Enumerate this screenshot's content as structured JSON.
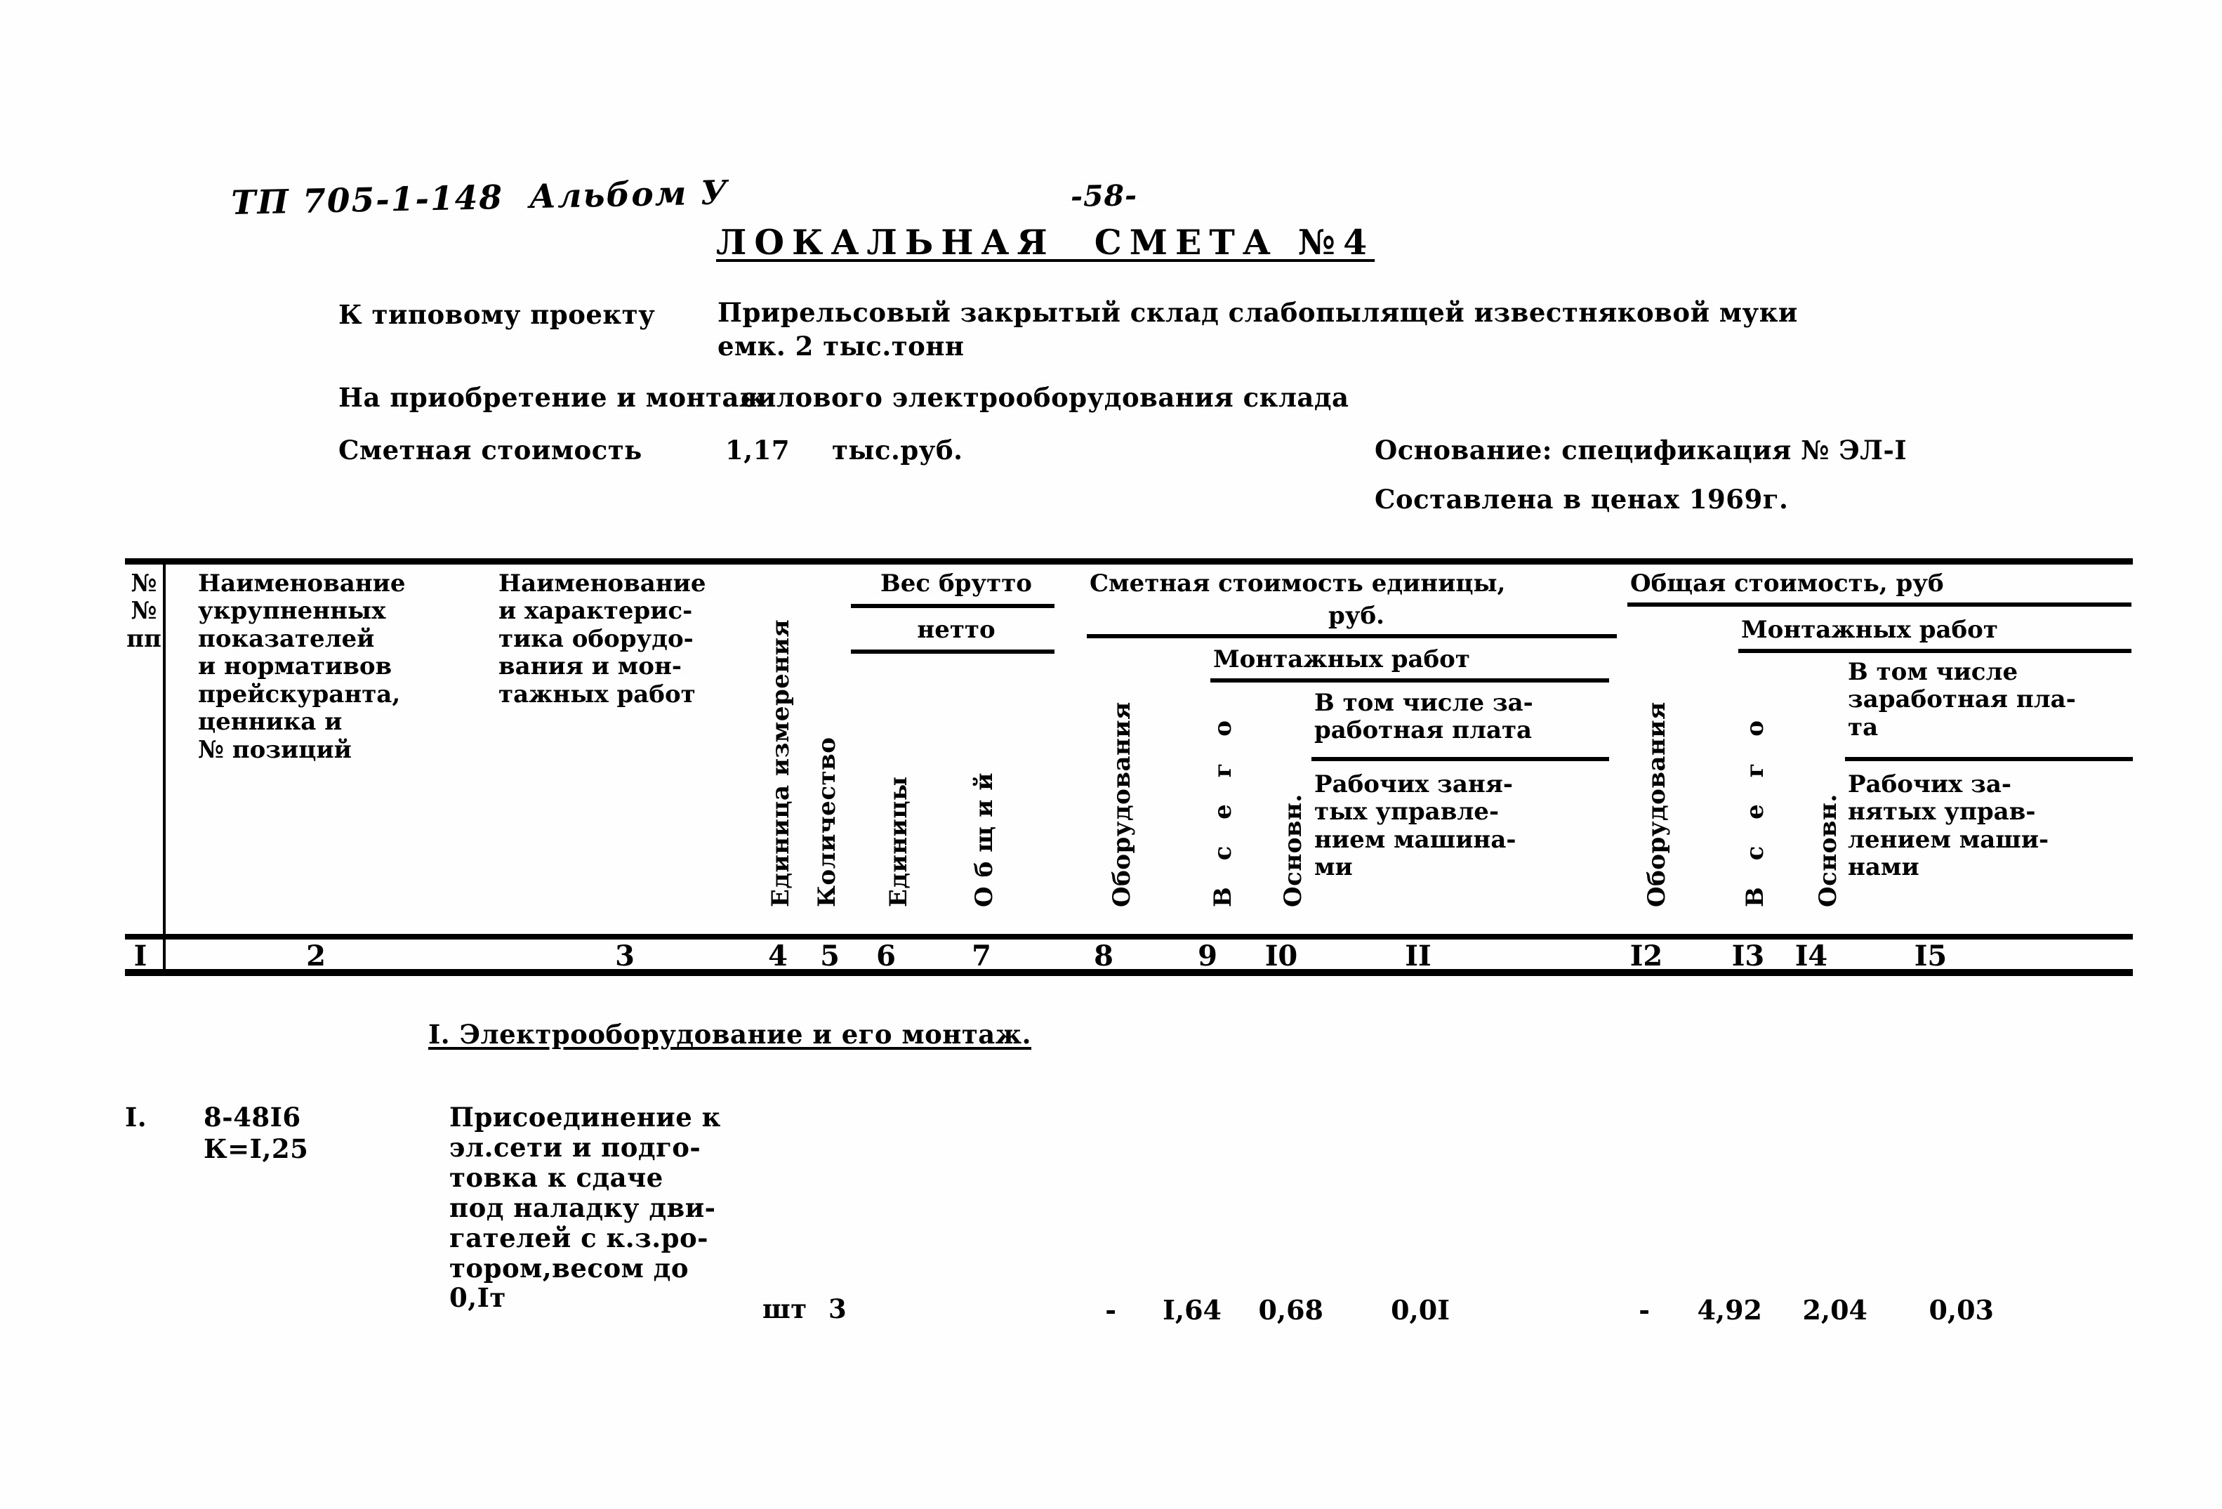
{
  "document": {
    "project_code": "ТП 705-1-148  Альбом У",
    "page_number": "-58-",
    "title": "ЛОКАЛЬНАЯ  СМЕТА №4",
    "to_project_label": "К типовому проекту",
    "to_project_value_line1": "Прирельсовый закрытый склад слабопылящей известняковой муки",
    "to_project_value_line2": "емк. 2 тыс.тонн",
    "purpose_label": "На приобретение и монтаж",
    "purpose_value": "силового электрооборудования склада",
    "estimate_cost_label": "Сметная стоимость",
    "estimate_cost_value": "1,17",
    "estimate_cost_unit": "тыс.руб.",
    "basis_line": "Основание: спецификация № ЭЛ-I",
    "prices_line": "Составлена в ценах 1969г."
  },
  "table": {
    "headers": {
      "col1": "№№\nпп",
      "col2": "Наименование\nукрупненных\nпоказателей\nи нормативов\nпрейскуранта,\nценника и\n№ позиций",
      "col3": "Наименование\nи характерис-\nтика оборудо-\nвания и мон-\nтажных работ",
      "col4_vertical": "Единица измерения",
      "col5_vertical": "Количество",
      "group_weight": "Вес брутто",
      "group_weight_sub": "нетто",
      "col6_vertical": "Единицы",
      "col7_vertical": "Общий",
      "group_unit_cost": "Сметная стоимость единицы,",
      "group_unit_cost_line2": "руб.",
      "col8_vertical": "Оборудования",
      "group_unit_install": "Монтажных работ",
      "col9_vertical": "В с е г о",
      "col10_vertical": "Основн.",
      "col10_text": "В том числе за-\nработная плата",
      "col11_text": "Рабочих заня-\nтых управле-\nнием машина-\nми",
      "group_total_cost": "Общая стоимость, руб",
      "col12_vertical": "Оборудования",
      "group_total_install": "Монтажных работ",
      "col13_vertical": "В с е г о",
      "col14_vertical": "Основн.",
      "col14_text": "В том числе\nзаработная пла-\nта",
      "col15_text": "Рабочих за-\nнятых управ-\nлением маши-\nнами"
    },
    "column_numbers": [
      "I",
      "2",
      "3",
      "4",
      "5",
      "6",
      "7",
      "8",
      "9",
      "I0",
      "II",
      "I2",
      "I3",
      "I4",
      "I5"
    ],
    "section_heading": "I. Электрооборудование и его монтаж.",
    "rows": [
      {
        "no": "I.",
        "code_line1": "8-48I6",
        "code_line2": "К=I,25",
        "description": "Присоединение к\nэл.сети и подго-\nтовка к сдаче\nпод наладку дви-\nгателей с к.з.ро-\nтором,весом до\n0,Iт",
        "unit": "шт",
        "quantity": "3",
        "weight_unit": "",
        "weight_total": "",
        "unit_equipment": "-",
        "unit_install_total": "I,64",
        "unit_install_base": "0,68",
        "unit_install_machines": "0,0I",
        "total_equipment": "-",
        "total_install_total": "4,92",
        "total_install_base": "2,04",
        "total_install_machines": "0,03"
      }
    ]
  }
}
